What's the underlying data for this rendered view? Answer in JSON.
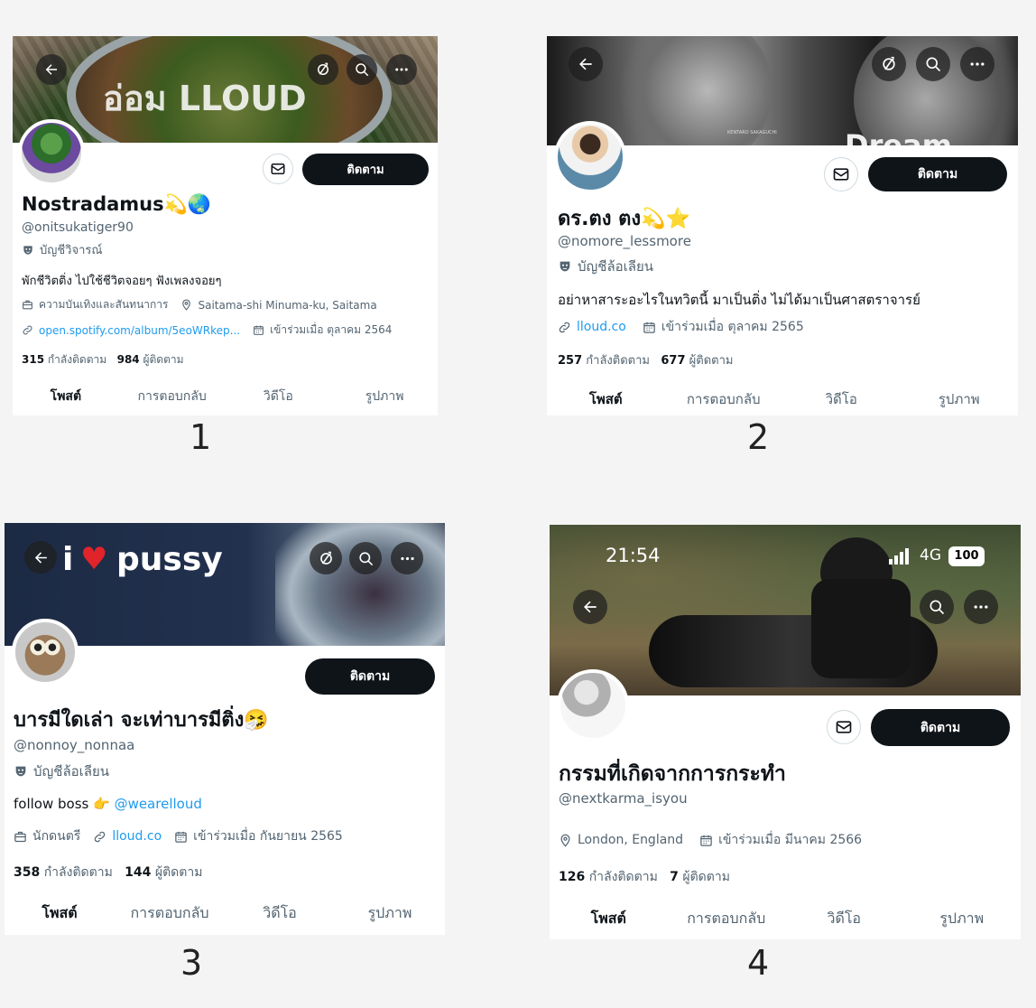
{
  "profiles": [
    {
      "number": "1",
      "banner_text": "อ่อม LLOUD",
      "name": "Nostradamus💫🌏",
      "handle": "@onitsukatiger90",
      "label": "บัญชีวิจารณ์",
      "bio": "พักชีวิตติ่ง ไปใช้ชีวิตจอยๆ ฟังเพลงจอยๆ",
      "category": "ความบันเทิงและสันทนาการ",
      "location": "Saitama-shi Minuma-ku, Saitama",
      "link": "open.spotify.com/album/5eoWRkep...",
      "joined": "เข้าร่วมเมื่อ ตุลาคม 2564",
      "following_count": "315",
      "following_label": "กำลังติดตาม",
      "followers_count": "984",
      "followers_label": "ผู้ติดตาม",
      "follow_label": "ติดตาม",
      "tabs": [
        "โพสต์",
        "การตอบกลับ",
        "วิดีโอ",
        "รูปภาพ"
      ]
    },
    {
      "number": "2",
      "banner_text": "Dream",
      "banner_small": "KENTARO SAKAGUCHI",
      "name": "ดร.ตง ตง💫⭐",
      "handle": "@nomore_lessmore",
      "label": "บัญชีล้อเลียน",
      "bio": "อย่าหาสาระอะไรในทวิตนี้ มาเป็นติ่ง ไม่ได้มาเป็นศาสตราจารย์",
      "link": "lloud.co",
      "joined": "เข้าร่วมเมื่อ ตุลาคม 2565",
      "following_count": "257",
      "following_label": "กำลังติดตาม",
      "followers_count": "677",
      "followers_label": "ผู้ติดตาม",
      "follow_label": "ติดตาม",
      "tabs": [
        "โพสต์",
        "การตอบกลับ",
        "วิดีโอ",
        "รูปภาพ"
      ]
    },
    {
      "number": "3",
      "banner_text_left": "i",
      "banner_text_right": "pussy",
      "name": "บารมีใดเล่า จะเท่าบารมีติ่ง🤧",
      "handle": "@nonnoy_nonnaa",
      "label": "บัญชีล้อเลียน",
      "bio_prefix": "follow boss 👉",
      "bio_mention": "@wearelloud",
      "category": "นักดนตรี",
      "link": "lloud.co",
      "joined": "เข้าร่วมเมื่อ กันยายน 2565",
      "following_count": "358",
      "following_label": "กำลังติดตาม",
      "followers_count": "144",
      "followers_label": "ผู้ติดตาม",
      "follow_label": "ติดตาม",
      "tabs": [
        "โพสต์",
        "การตอบกลับ",
        "วิดีโอ",
        "รูปภาพ"
      ]
    },
    {
      "number": "4",
      "status_time": "21:54",
      "status_network": "4G",
      "status_battery": "100",
      "name": "กรรมที่เกิดจากการกระทำ",
      "handle": "@nextkarma_isyou",
      "location": "London, England",
      "joined": "เข้าร่วมเมื่อ มีนาคม 2566",
      "following_count": "126",
      "following_label": "กำลังติดตาม",
      "followers_count": "7",
      "followers_label": "ผู้ติดตาม",
      "follow_label": "ติดตาม",
      "tabs": [
        "โพสต์",
        "การตอบกลับ",
        "วิดีโอ",
        "รูปภาพ"
      ]
    }
  ],
  "icons": [
    "back-arrow-icon",
    "no-notification-icon",
    "search-icon",
    "more-icon",
    "mail-icon",
    "parody-mask-icon",
    "briefcase-icon",
    "location-pin-icon",
    "link-icon",
    "calendar-icon"
  ]
}
